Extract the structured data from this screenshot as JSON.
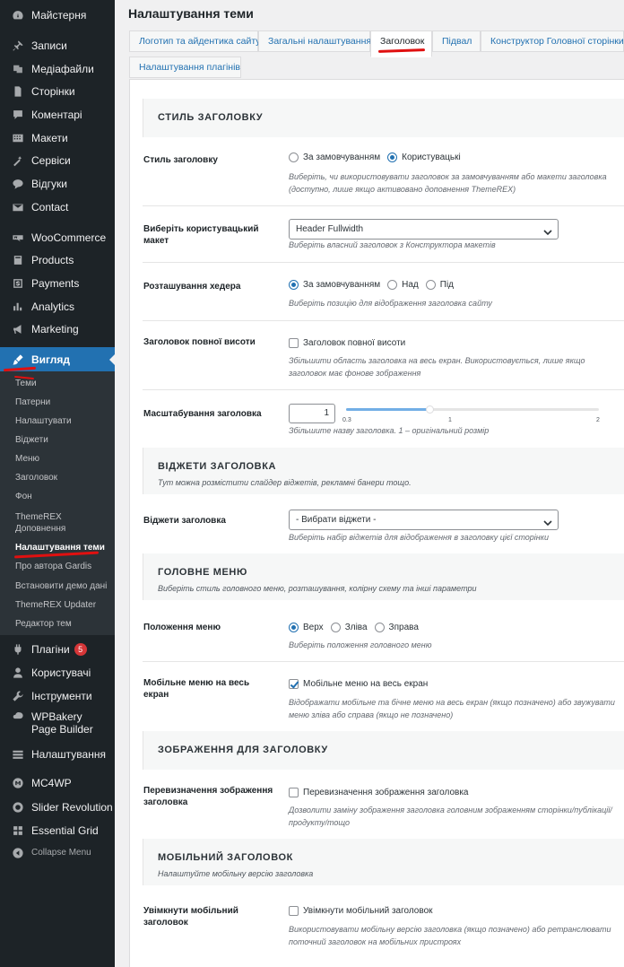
{
  "sidebar": {
    "items": [
      {
        "label": "Майстерня",
        "icon": "dashboard-icon"
      },
      {
        "label": "Записи",
        "icon": "pin-icon"
      },
      {
        "label": "Медіафайли",
        "icon": "media-icon"
      },
      {
        "label": "Сторінки",
        "icon": "page-icon"
      },
      {
        "label": "Коментарі",
        "icon": "comment-icon"
      },
      {
        "label": "Макети",
        "icon": "layout-icon"
      },
      {
        "label": "Сервіси",
        "icon": "tools-wand-icon"
      },
      {
        "label": "Відгуки",
        "icon": "testimonial-icon"
      },
      {
        "label": "Contact",
        "icon": "mail-icon"
      },
      {
        "label": "WooCommerce",
        "icon": "woocommerce-icon"
      },
      {
        "label": "Products",
        "icon": "products-icon"
      },
      {
        "label": "Payments",
        "icon": "payments-icon"
      },
      {
        "label": "Analytics",
        "icon": "analytics-icon"
      },
      {
        "label": "Marketing",
        "icon": "marketing-icon"
      },
      {
        "label": "Вигляд",
        "icon": "appearance-brush-icon"
      },
      {
        "label": "Плагіни",
        "icon": "plugins-icon",
        "badge": "5"
      },
      {
        "label": "Користувачі",
        "icon": "users-icon"
      },
      {
        "label": "Інструменти",
        "icon": "wrench-icon"
      },
      {
        "label": "WPBakery Page Builder",
        "icon": "wpbakery-icon"
      },
      {
        "label": "Налаштування",
        "icon": "settings-icon"
      },
      {
        "label": "MC4WP",
        "icon": "mc4wp-icon"
      },
      {
        "label": "Slider Revolution",
        "icon": "slider-revolution-icon"
      },
      {
        "label": "Essential Grid",
        "icon": "grid-icon"
      },
      {
        "label": "Collapse Menu",
        "icon": "collapse-icon"
      }
    ],
    "submenu": [
      "Теми",
      "Патерни",
      "Налаштувати",
      "Віджети",
      "Меню",
      "Заголовок",
      "Фон",
      "ThemeREX Доповнення",
      "Налаштування теми",
      "Про автора Gardis",
      "Встановити демо дані",
      "ThemeREX Updater",
      "Редактор тем"
    ]
  },
  "page": {
    "title": "Налаштування теми",
    "tabs": [
      "Логотип та айдентика сайту",
      "Загальні налаштування",
      "Заголовок",
      "Підвал",
      "Конструктор Головної сторінки",
      "Налаштування плагінів"
    ]
  },
  "sections": {
    "header_style": {
      "title": "СТИЛЬ ЗАГОЛОВКУ"
    },
    "widgets": {
      "title": "ВІДЖЕТИ ЗАГОЛОВКА",
      "desc": "Тут можна розмістити слайдер віджетів, рекламні банери тощо."
    },
    "main_menu": {
      "title": "ГОЛОВНЕ МЕНЮ",
      "desc": "Виберіть стиль головного меню, розташування, колірну схему та інші параметри"
    },
    "header_image": {
      "title": "ЗОБРАЖЕННЯ ДЛЯ ЗАГОЛОВКУ"
    },
    "mobile_header": {
      "title": "МОБІЛЬНИЙ ЗАГОЛОВОК",
      "desc": "Налаштуйте мобільну версію заголовка"
    }
  },
  "fields": {
    "header_style": {
      "label": "Стиль заголовку",
      "options": [
        "За замовчуванням",
        "Користувацькі"
      ],
      "selected": 1,
      "desc": "Виберіть, чи використовувати заголовок за замовчуванням або макети заголовка (доступно, лише якщо активовано доповнення ThemeREX)"
    },
    "custom_layout": {
      "label": "Виберіть користувацький макет",
      "value": "Header Fullwidth",
      "desc": "Виберіть власний заголовок з Конструктора макетів"
    },
    "header_position": {
      "label": "Розташування хедера",
      "options": [
        "За замовчуванням",
        "Над",
        "Під"
      ],
      "selected": 0,
      "desc": "Виберіть позицію для відображення заголовка сайту"
    },
    "fullheight": {
      "label": "Заголовок повної висоти",
      "checkbox": "Заголовок повної висоти",
      "checked": false,
      "desc": "Збільшити область заголовка на весь екран. Використовується, лише якщо заголовок має фонове зображення"
    },
    "zoom": {
      "label": "Масштабування заголовка",
      "value": "1",
      "min_label": "0.3",
      "mid_label": "1",
      "max_label": "2",
      "range": [
        0.3,
        2
      ],
      "desc": "Збільшите назву заголовка. 1 – оригінальний розмір"
    },
    "header_widgets": {
      "label": "Віджети заголовка",
      "value": "- Вибрати віджети -",
      "desc": "Виберіть набір віджетів для відображення в заголовку цієї сторінки"
    },
    "menu_position": {
      "label": "Положення меню",
      "options": [
        "Верх",
        "Зліва",
        "Зправа"
      ],
      "selected": 0,
      "desc": "Виберіть положення головного меню"
    },
    "mobile_fullscreen": {
      "label": "Мобільне меню на весь екран",
      "checkbox": "Мобільне меню на весь екран",
      "checked": true,
      "desc": "Відображати мобільне та бічне меню на весь екран (якщо позначено) або звужувати меню зліва або справа (якщо не позначено)"
    },
    "image_override": {
      "label": "Перевизначення зображення заголовка",
      "checkbox": "Перевизначення зображення заголовка",
      "checked": false,
      "desc": "Дозволити заміну зображення заголовка головним зображенням сторінки/публікації/продукту/тощо"
    },
    "mobile_enable": {
      "label": "Увімкнути мобільний заголовок",
      "checkbox": "Увімкнути мобільний заголовок",
      "checked": false,
      "desc": "Використовувати мобільну версію заголовка (якщо позначено) або ретранслювати поточний заголовок на мобільних пристроях"
    }
  },
  "colors": {
    "sidebar_bg": "#1d2327",
    "submenu_bg": "#2c3338",
    "accent": "#2271b1",
    "annotation_red": "#e01010"
  }
}
